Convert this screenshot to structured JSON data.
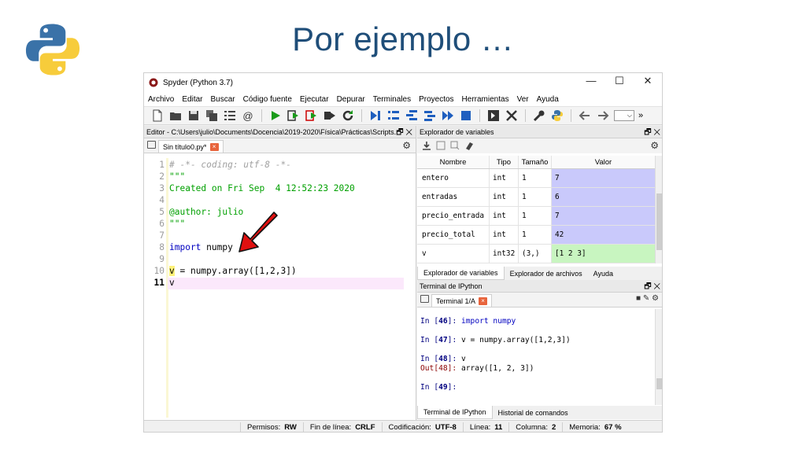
{
  "slide": {
    "title": "Por ejemplo …"
  },
  "window": {
    "title": "Spyder (Python 3.7)"
  },
  "controls": {
    "minimize": "—",
    "maximize": "☐",
    "close": "✕"
  },
  "menu": [
    "Archivo",
    "Editar",
    "Buscar",
    "Código fuente",
    "Ejecutar",
    "Depurar",
    "Terminales",
    "Proyectos",
    "Herramientas",
    "Ver",
    "Ayuda"
  ],
  "toolbar": {
    "icons": [
      "new-file-icon",
      "open-folder-icon",
      "save-icon",
      "save-all-icon",
      "outline-icon",
      "at-icon",
      "run-icon",
      "run-cell-icon",
      "run-cell-advance-icon",
      "run-selection-icon",
      "rerun-icon",
      "debug-icon",
      "step-icon",
      "step-into-icon",
      "continue-icon",
      "stop-icon",
      "maximize-pane-icon",
      "fullscreen-icon",
      "wrench-icon",
      "python-path-icon",
      "back-icon",
      "forward-icon"
    ],
    "at_glyph": "@",
    "combo_arrow": "⌵",
    "overflow": "»"
  },
  "editor": {
    "header": "Editor - C:\\Users\\julio\\Documents\\Docencia\\2019-2020\\Física\\Prácticas\\Scripts...",
    "tab_label": "Sin título0.py*",
    "tab_close": "×",
    "header_ctl": "🗗 ✕",
    "gear": "⚙",
    "lines": [
      {
        "n": "1",
        "parts": [
          {
            "t": "# -*- coding: utf-8 -*-",
            "c": "c-comment"
          }
        ]
      },
      {
        "n": "2",
        "parts": [
          {
            "t": "\"\"\"",
            "c": "c-string"
          }
        ]
      },
      {
        "n": "3",
        "parts": [
          {
            "t": "Created on Fri Sep  4 12:52:23 2020",
            "c": "c-string"
          }
        ]
      },
      {
        "n": "4",
        "parts": [
          {
            "t": "",
            "c": "c-string"
          }
        ]
      },
      {
        "n": "5",
        "parts": [
          {
            "t": "@author: julio",
            "c": "c-string"
          }
        ]
      },
      {
        "n": "6",
        "parts": [
          {
            "t": "\"\"\"",
            "c": "c-string"
          }
        ]
      },
      {
        "n": "7",
        "parts": [
          {
            "t": "",
            "c": "c-plain"
          }
        ]
      },
      {
        "n": "8",
        "parts": [
          {
            "t": "import",
            "c": "c-kw"
          },
          {
            "t": " numpy",
            "c": "c-plain"
          }
        ]
      },
      {
        "n": "9",
        "parts": [
          {
            "t": "",
            "c": "c-plain"
          }
        ]
      },
      {
        "n": "10",
        "parts": [
          {
            "t": "v",
            "c": "c-plain sel-v"
          },
          {
            "t": " = numpy.array([1,2,3])",
            "c": "c-plain"
          }
        ]
      },
      {
        "n": "11",
        "parts": [
          {
            "t": "v",
            "c": "c-plain"
          }
        ],
        "current": true
      }
    ]
  },
  "variables": {
    "header": "Explorador de variables",
    "header_ctl": "🗗 ✕",
    "gear": "⚙",
    "columns": [
      "Nombre",
      "Tipo",
      "Tamaño",
      "Valor"
    ],
    "rows": [
      {
        "name": "entero",
        "type": "int",
        "size": "1",
        "value": "7",
        "color": "#c9c9fb"
      },
      {
        "name": "entradas",
        "type": "int",
        "size": "1",
        "value": "6",
        "color": "#c9c9fb"
      },
      {
        "name": "precio_entrada",
        "type": "int",
        "size": "1",
        "value": "7",
        "color": "#c9c9fb"
      },
      {
        "name": "precio_total",
        "type": "int",
        "size": "1",
        "value": "42",
        "color": "#c9c9fb"
      },
      {
        "name": "v",
        "type": "int32",
        "size": "(3,)",
        "value": "[1 2 3]",
        "color": "#c8f5c0"
      }
    ],
    "tabs": [
      "Explorador de variables",
      "Explorador de archivos",
      "Ayuda"
    ]
  },
  "terminal": {
    "header": "Terminal de IPython",
    "header_ctl": "🗗 ✕",
    "tab_label": "Terminal 1/A",
    "tab_close": "×",
    "ctl": "■ ✎ ⚙",
    "lines": [
      {
        "kind": "in",
        "prompt": "In [",
        "num": "46",
        "end": "]: ",
        "code": "import numpy",
        "kw": true
      },
      {
        "kind": "gap"
      },
      {
        "kind": "in",
        "prompt": "In [",
        "num": "47",
        "end": "]: ",
        "code": "v = numpy.array([1,2,3])"
      },
      {
        "kind": "gap"
      },
      {
        "kind": "in",
        "prompt": "In [",
        "num": "48",
        "end": "]: ",
        "code": "v"
      },
      {
        "kind": "out",
        "prompt": "Out[48]: ",
        "code": "array([1, 2, 3])"
      },
      {
        "kind": "gap"
      },
      {
        "kind": "in",
        "prompt": "In [",
        "num": "49",
        "end": "]: ",
        "code": ""
      }
    ],
    "tabs": [
      "Terminal de IPython",
      "Historial de comandos"
    ]
  },
  "status": [
    {
      "label": "Permisos:",
      "value": "RW"
    },
    {
      "label": "Fin de línea:",
      "value": "CRLF"
    },
    {
      "label": "Codificación:",
      "value": "UTF-8"
    },
    {
      "label": "Línea:",
      "value": "11"
    },
    {
      "label": "Columna:",
      "value": "2"
    },
    {
      "label": "Memoria:",
      "value": "67 %"
    }
  ],
  "colors": {
    "title": "#1f4e79",
    "python_blue": "#3a72a8",
    "python_yellow": "#f7cc3b",
    "arrow": "#e01010"
  }
}
